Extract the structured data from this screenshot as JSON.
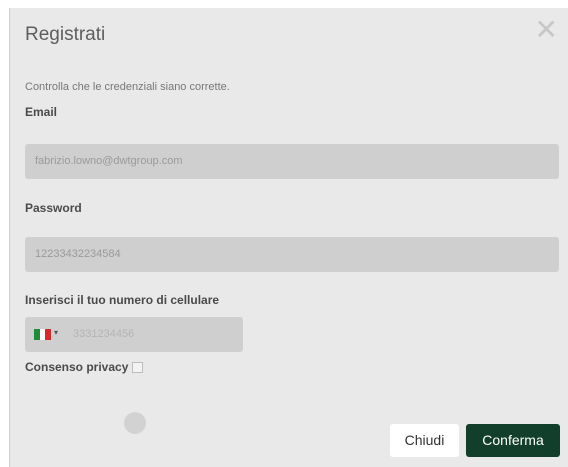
{
  "dialog": {
    "title": "Registrati",
    "close_icon": "close-icon",
    "intro": "Controlla che le credenziali siano corrette."
  },
  "form": {
    "email_label": "Email",
    "email_value": "fabrizio.lowno@dwtgroup.com",
    "password_label": "Password",
    "password_value": "12233432234584",
    "phone_label": "Inserisci il tuo numero di cellulare",
    "phone_country_icon": "italy-flag-icon",
    "phone_value": "3331234456",
    "privacy_label": "Consenso privacy",
    "privacy_checked": false
  },
  "footer": {
    "close_label": "Chiudi",
    "confirm_label": "Conferma"
  },
  "colors": {
    "confirm_bg": "#123f2b",
    "input_bg": "#cfcfcf",
    "modal_bg": "#e9e9e9"
  }
}
